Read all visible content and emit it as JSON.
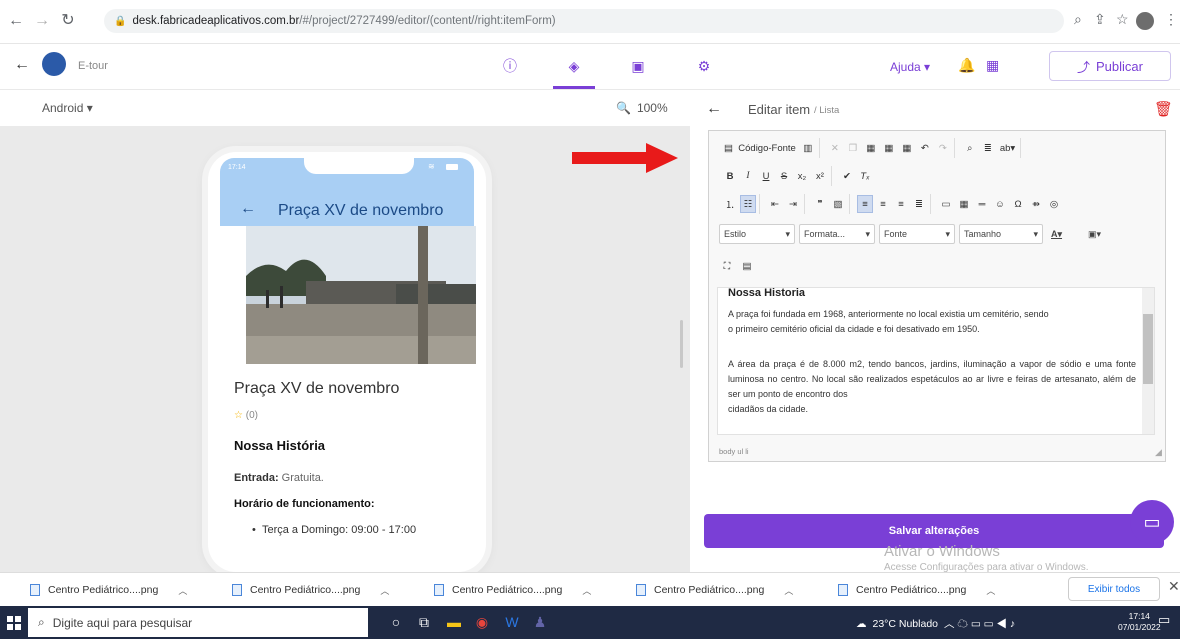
{
  "browser": {
    "url_domain": "desk.fabricadeaplicativos.com.br",
    "url_path": "/#/project/2727499/editor/(content//right:itemForm)"
  },
  "app": {
    "name": "E-tour",
    "help_label": "Ajuda",
    "publish_label": "Publicar",
    "platform": "Android",
    "zoom": "100%"
  },
  "editor": {
    "title": "Editar item",
    "subtitle": "/ Lista",
    "toolbar": {
      "source_label": "Código-Fonte",
      "style_label": "Estilo",
      "format_label": "Formata...",
      "font_label": "Fonte",
      "size_label": "Tamanho"
    },
    "content": {
      "heading": "Nossa Historia",
      "p1_line1": "A praça foi fundada em 1968, anteriormente no local existia um cemitério, sendo",
      "p1_line2": "o primeiro cemitério oficial da cidade e foi desativado em 1950.",
      "p2": "A área da praça é de 8.000 m2, tendo bancos, jardins, iluminação a vapor de sódio e uma fonte luminosa no centro. No local são realizados espetáculos ao ar livre e feiras de artesanato, além de ser um ponto de encontro dos",
      "p3": "cidadãos da cidade."
    },
    "path": "body  ul  li",
    "save_label": "Salvar alterações"
  },
  "phone": {
    "time": "17:14",
    "title": "Praça XV de novembro",
    "place_title": "Praça XV de novembro",
    "rating": "(0)",
    "heading": "Nossa História",
    "entry_label": "Entrada:",
    "entry_value": " Gratuita.",
    "hours_label": "Horário de funcionamento:",
    "hours_value": "Terça a Domingo: 09:00 - 17:00"
  },
  "watermark": {
    "title": "Ativar o Windows",
    "subtitle": "Acesse Configurações para ativar o Windows."
  },
  "downloads": {
    "items": [
      "Centro Pediátrico....png",
      "Centro Pediátrico....png",
      "Centro Pediátrico....png",
      "Centro Pediátrico....png",
      "Centro Pediátrico....png"
    ],
    "show_all": "Exibir todos"
  },
  "taskbar": {
    "search_placeholder": "Digite aqui para pesquisar",
    "weather": "23°C  Nublado",
    "time": "17:14",
    "date": "07/01/2022"
  },
  "colors": {
    "accent": "#7a3fd6",
    "phone_bar": "#a9cff4",
    "arrow": "#e81a1a",
    "taskbar": "#1f2a44"
  }
}
